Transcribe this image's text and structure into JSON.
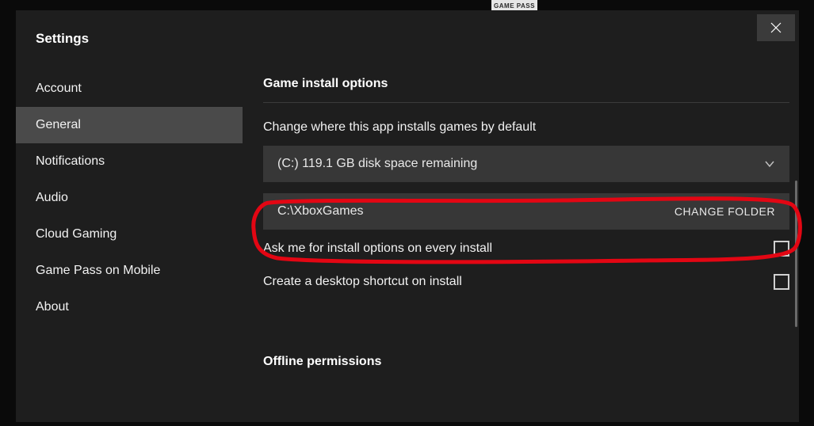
{
  "backdrop": {
    "badge": "GAME PASS"
  },
  "dialog": {
    "title": "Settings",
    "sidebar": {
      "items": [
        {
          "label": "Account",
          "id": "account"
        },
        {
          "label": "General",
          "id": "general"
        },
        {
          "label": "Notifications",
          "id": "notifications"
        },
        {
          "label": "Audio",
          "id": "audio"
        },
        {
          "label": "Cloud Gaming",
          "id": "cloud-gaming"
        },
        {
          "label": "Game Pass on Mobile",
          "id": "game-pass-mobile"
        },
        {
          "label": "About",
          "id": "about"
        }
      ],
      "active": "general"
    },
    "content": {
      "section_title": "Game install options",
      "change_where_label": "Change where this app installs games by default",
      "drive_selector": "(C:) 119.1 GB disk space remaining",
      "folder_path": "C:\\XboxGames",
      "change_folder_label": "CHANGE FOLDER",
      "ask_install_label": "Ask me for install options on every install",
      "ask_install_checked": false,
      "desktop_shortcut_label": "Create a desktop shortcut on install",
      "desktop_shortcut_checked": false,
      "offline_section_title": "Offline permissions"
    }
  }
}
